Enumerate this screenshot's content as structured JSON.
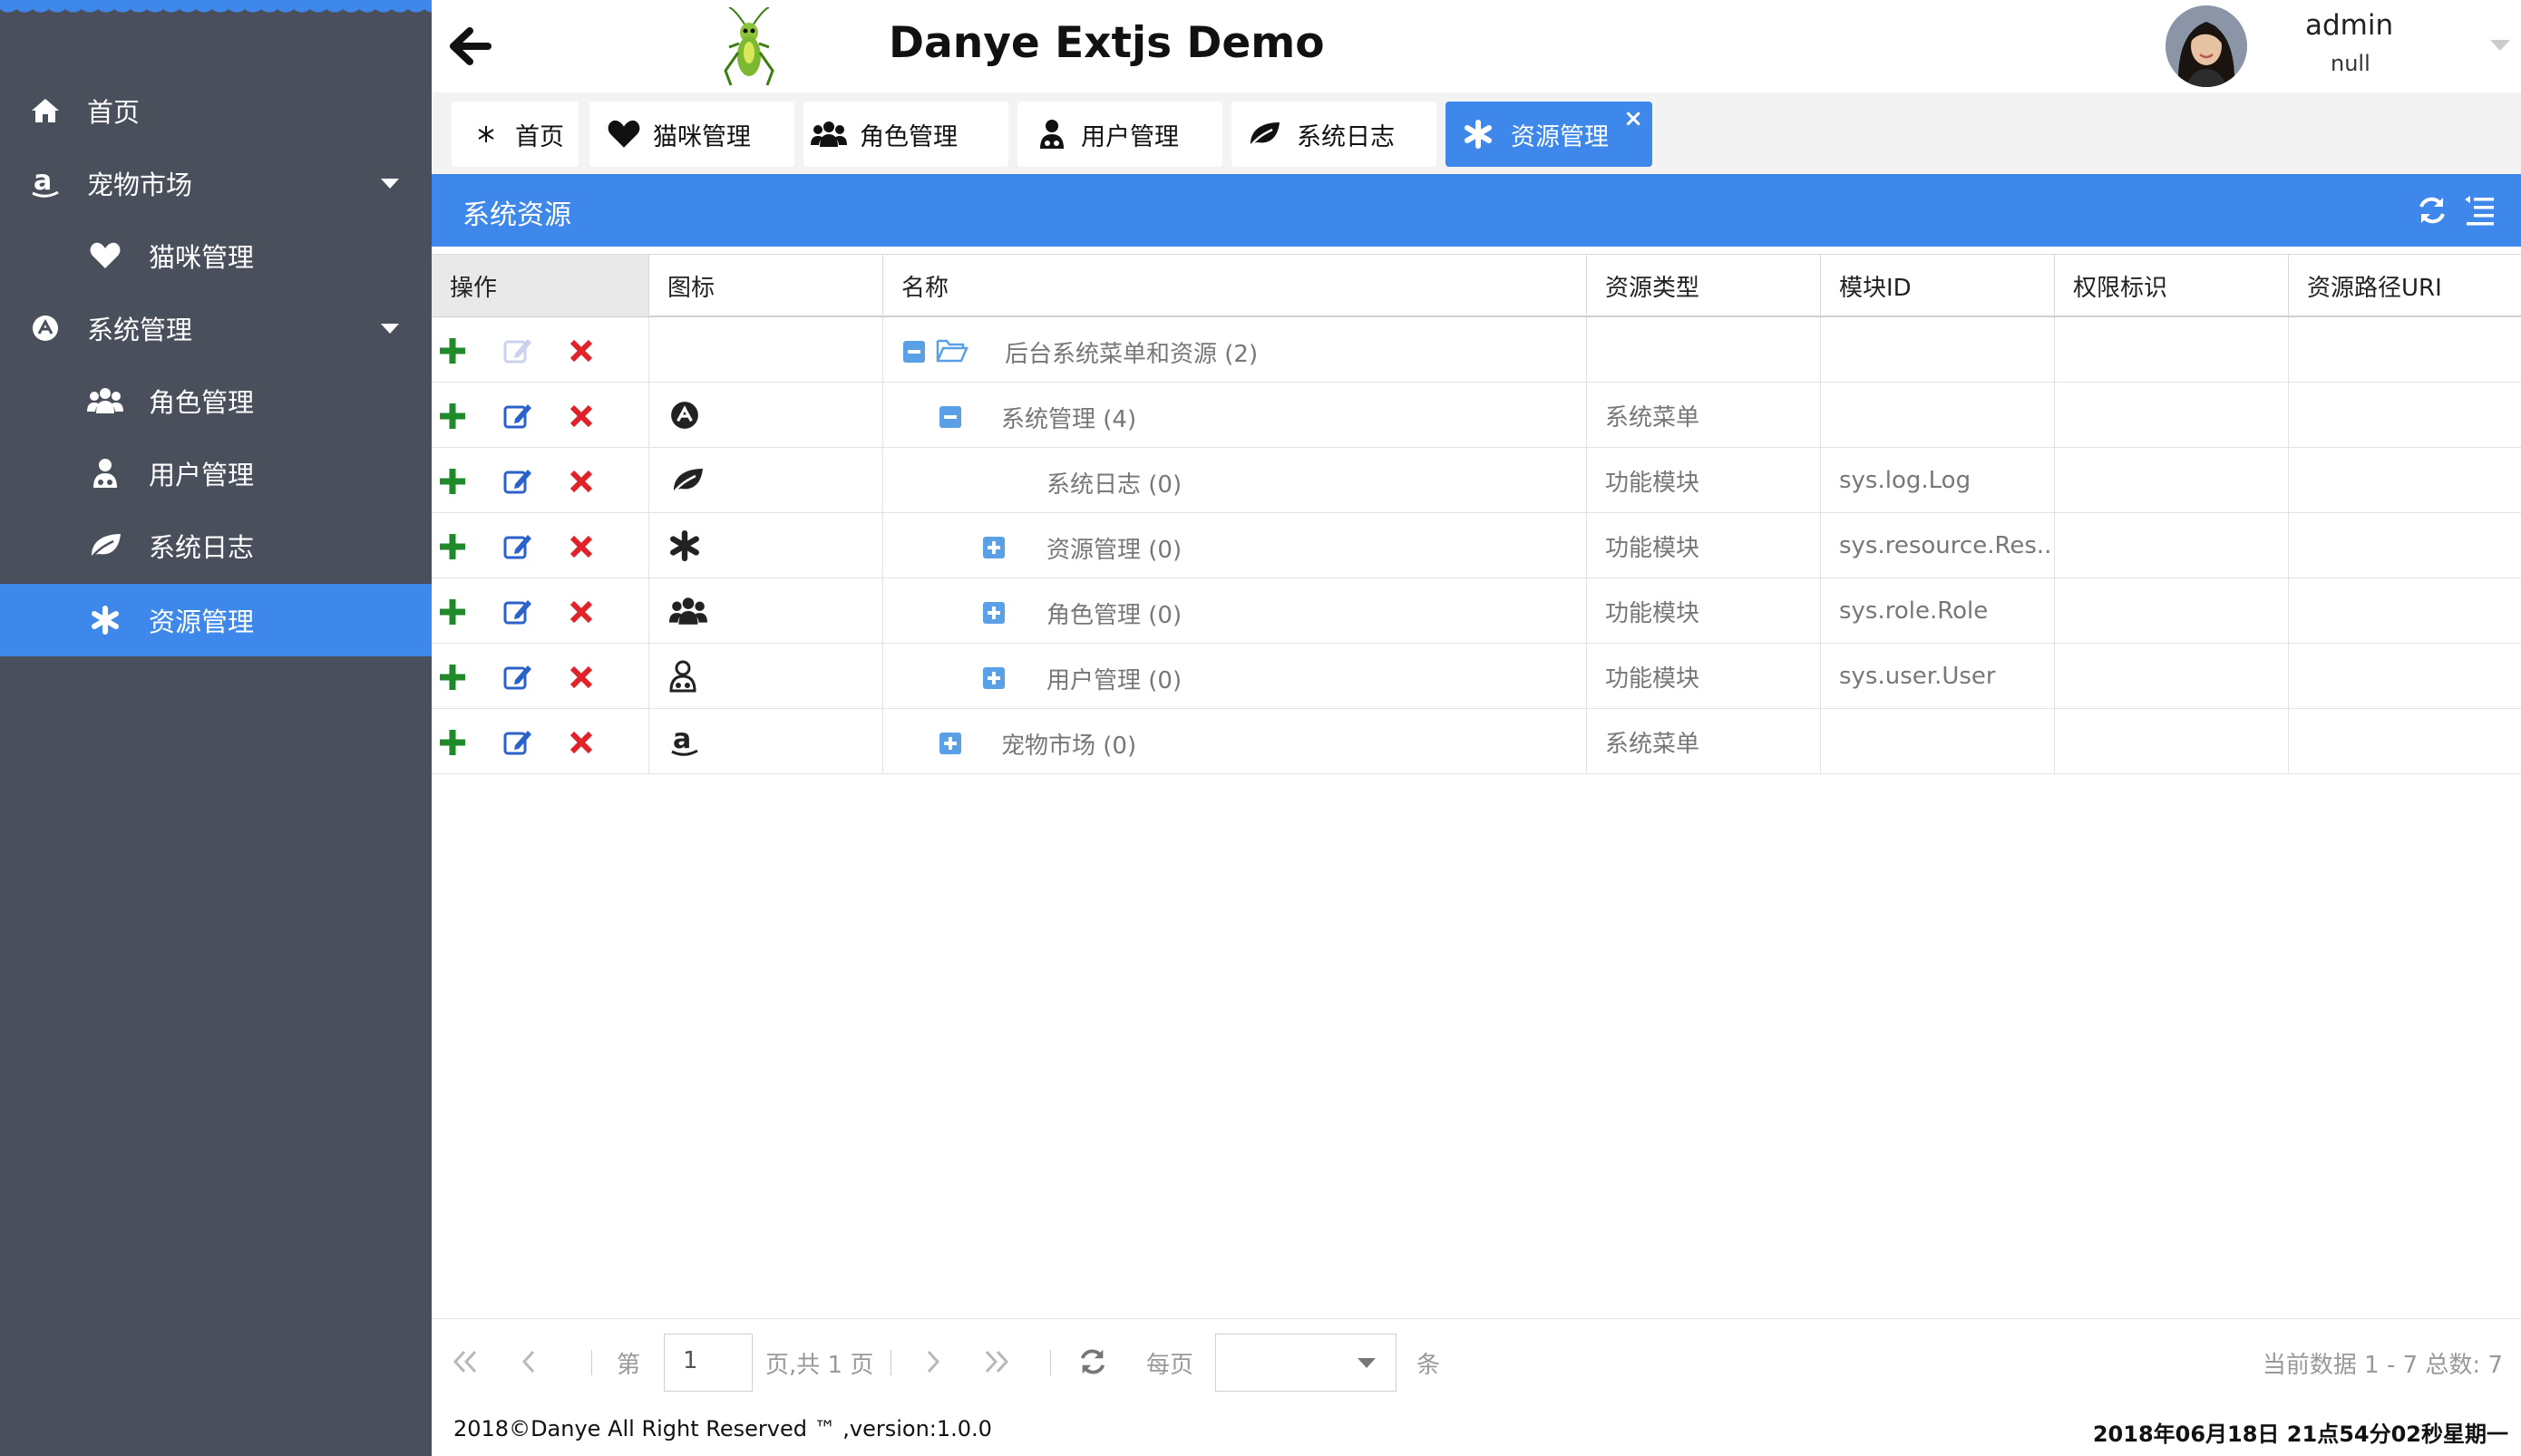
{
  "header": {
    "title": "Danye Extjs Demo",
    "user_name": "admin",
    "user_sub": "null"
  },
  "sidebar": {
    "items": [
      {
        "label": "首页",
        "icon": "home-icon"
      },
      {
        "label": "宠物市场",
        "icon": "amazon-icon"
      },
      {
        "label": "猫咪管理",
        "icon": "heart-icon"
      },
      {
        "label": "系统管理",
        "icon": "android-icon"
      },
      {
        "label": "角色管理",
        "icon": "users-icon"
      },
      {
        "label": "用户管理",
        "icon": "user-md-icon"
      },
      {
        "label": "系统日志",
        "icon": "leaf-icon"
      },
      {
        "label": "资源管理",
        "icon": "asterisk-icon"
      }
    ]
  },
  "tabs": [
    {
      "label": "首页",
      "icon": "asterisk-small-icon"
    },
    {
      "label": "猫咪管理",
      "icon": "heart-icon"
    },
    {
      "label": "角色管理",
      "icon": "users-icon"
    },
    {
      "label": "用户管理",
      "icon": "user-md-icon"
    },
    {
      "label": "系统日志",
      "icon": "leaf-icon"
    },
    {
      "label": "资源管理",
      "icon": "asterisk-icon",
      "active": true
    }
  ],
  "panel": {
    "title": "系统资源"
  },
  "grid": {
    "columns": [
      "操作",
      "图标",
      "名称",
      "资源类型",
      "模块ID",
      "权限标识",
      "资源路径URI"
    ],
    "rows": [
      {
        "name": "后台系统菜单和资源 (2)",
        "icon": "",
        "type": "",
        "module": "",
        "perm": "",
        "uri": "",
        "toggle": "minus",
        "folder": true
      },
      {
        "name": "系统管理 (4)",
        "icon": "android-icon",
        "type": "系统菜单",
        "module": "",
        "perm": "",
        "uri": "",
        "toggle": "minus"
      },
      {
        "name": "系统日志 (0)",
        "icon": "leaf-icon",
        "type": "功能模块",
        "module": "sys.log.Log",
        "perm": "",
        "uri": "",
        "toggle": "none"
      },
      {
        "name": "资源管理 (0)",
        "icon": "asterisk-icon",
        "type": "功能模块",
        "module": "sys.resource.Res...",
        "perm": "",
        "uri": "",
        "toggle": "plus"
      },
      {
        "name": "角色管理 (0)",
        "icon": "users-icon",
        "type": "功能模块",
        "module": "sys.role.Role",
        "perm": "",
        "uri": "",
        "toggle": "plus"
      },
      {
        "name": "用户管理 (0)",
        "icon": "user-md-icon",
        "type": "功能模块",
        "module": "sys.user.User",
        "perm": "",
        "uri": "",
        "toggle": "plus"
      },
      {
        "name": "宠物市场 (0)",
        "icon": "amazon-icon",
        "type": "系统菜单",
        "module": "",
        "perm": "",
        "uri": "",
        "toggle": "plus"
      }
    ]
  },
  "pager": {
    "page_prefix": "第",
    "page_value": "1",
    "page_suffix": "页,共 1 页",
    "per_page": "每页",
    "per_page_unit": "条",
    "summary": "当前数据 1 - 7 总数:  7"
  },
  "footer": {
    "copyright": "2018©Danye All Right Reserved ™ ,version:1.0.0",
    "datetime": "2018年06月18日 21点54分02秒星期一"
  },
  "colors": {
    "accent": "#3d88ea",
    "sidebar": "#4a4f5c",
    "add": "#1f8a2a",
    "delete": "#e0232b",
    "edit": "#2a62c9"
  }
}
